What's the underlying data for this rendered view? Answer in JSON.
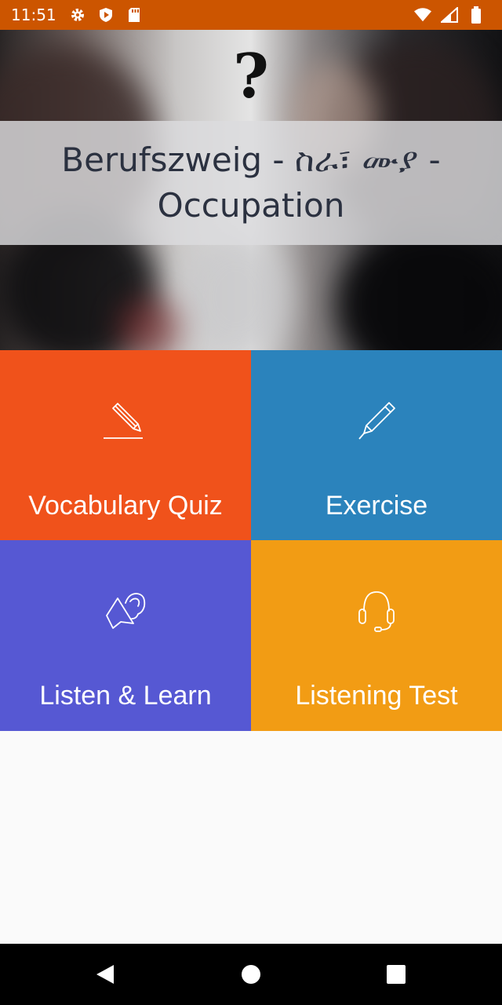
{
  "status_bar": {
    "time": "11:51",
    "left_icons": [
      "gear-icon",
      "play-protect-icon",
      "sd-card-icon"
    ],
    "right_icons": [
      "wifi-icon",
      "signal-icon",
      "battery-icon"
    ]
  },
  "hero": {
    "symbol": "?",
    "title": "Berufszweig - ስራ፣ ሙያ - Occupation"
  },
  "tiles": [
    {
      "label": "Vocabulary Quiz",
      "icon": "pencil-writing-icon",
      "color": "#f0521b"
    },
    {
      "label": "Exercise",
      "icon": "pencil-icon",
      "color": "#2b83bc"
    },
    {
      "label": "Listen & Learn",
      "icon": "speaker-ear-icon",
      "color": "#5658d3"
    },
    {
      "label": "Listening Test",
      "icon": "headset-icon",
      "color": "#f29c14"
    }
  ],
  "nav_bar": {
    "buttons": [
      "back-icon",
      "home-icon",
      "recent-apps-icon"
    ]
  }
}
